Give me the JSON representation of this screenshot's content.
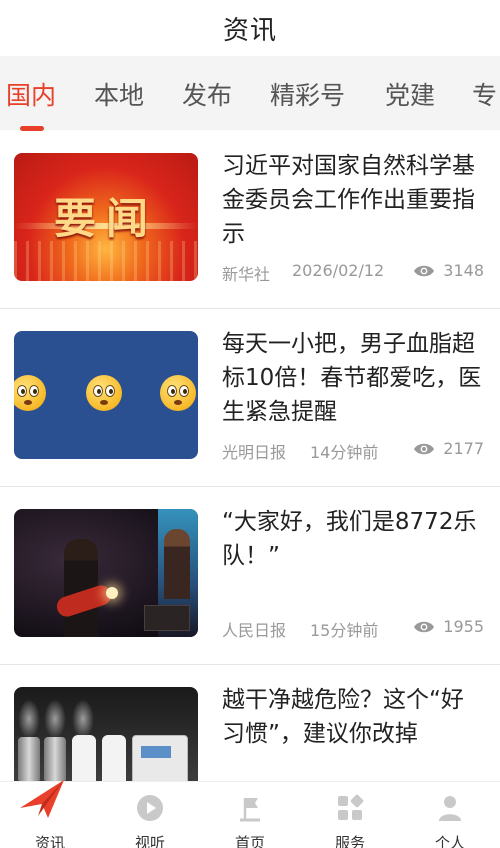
{
  "header": {
    "title": "资讯"
  },
  "tabs": [
    {
      "label": "国内",
      "active": true
    },
    {
      "label": "本地",
      "active": false
    },
    {
      "label": "发布",
      "active": false
    },
    {
      "label": "精彩号",
      "active": false
    },
    {
      "label": "党建",
      "active": false
    },
    {
      "label": "专",
      "active": false
    }
  ],
  "feed": {
    "items": [
      {
        "title": "习近平对国家自然科学基金委员会工作作出重要指示",
        "source": "新华社",
        "time": "2026/02/12",
        "views": "3148",
        "thumb_text": "要闻"
      },
      {
        "title": "每天一小把，男子血脂超标10倍！春节都爱吃，医生紧急提醒",
        "source": "光明日报",
        "time": "14分钟前",
        "views": "2177"
      },
      {
        "title": "“大家好，我们是8772乐队！”",
        "source": "人民日报",
        "time": "15分钟前",
        "views": "1955"
      },
      {
        "title": "越干净越危险？这个“好习惯”，建议你改掉",
        "source": "",
        "time": "",
        "views": ""
      }
    ]
  },
  "bottom_nav": [
    {
      "label": "资讯",
      "icon": "paper-plane-icon",
      "active": true
    },
    {
      "label": "视听",
      "icon": "play-icon",
      "active": false
    },
    {
      "label": "首页",
      "icon": "home-flag-icon",
      "active": false
    },
    {
      "label": "服务",
      "icon": "grid-icon",
      "active": false
    },
    {
      "label": "个人",
      "icon": "person-icon",
      "active": false
    }
  ],
  "colors": {
    "accent": "#e8402a",
    "tab_bg": "#f4f4f4",
    "meta": "#999999"
  }
}
